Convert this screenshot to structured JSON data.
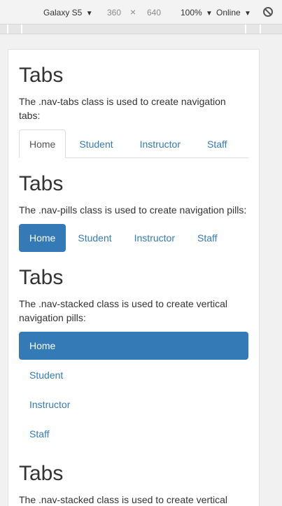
{
  "toolbar": {
    "device": "Galaxy S5",
    "width": "360",
    "times": "×",
    "height": "640",
    "zoom": "100%",
    "network": "Online",
    "caret": "▼"
  },
  "sections": [
    {
      "title": "Tabs",
      "description": "The .nav-tabs class is used to create navigation tabs:",
      "items": [
        "Home",
        "Student",
        "Instructor",
        "Staff"
      ]
    },
    {
      "title": "Tabs",
      "description": "The .nav-pills class is used to create navigation pills:",
      "items": [
        "Home",
        "Student",
        "Instructor",
        "Staff"
      ]
    },
    {
      "title": "Tabs",
      "description": "The .nav-stacked class is used to create vertical navigation pills:",
      "items": [
        "Home",
        "Student",
        "Instructor",
        "Staff"
      ]
    },
    {
      "title": "Tabs",
      "description": "The .nav-stacked class is used to create vertical navigation pills:"
    }
  ],
  "colors": {
    "primary": "#337ab7",
    "text": "#333333"
  }
}
